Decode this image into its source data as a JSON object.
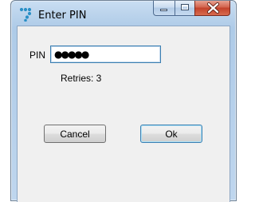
{
  "window": {
    "title": "Enter PIN",
    "icon": "app-dots-icon",
    "controls": {
      "minimize": "minimize-icon",
      "maximize": "maximize-icon",
      "close": "close-icon"
    }
  },
  "form": {
    "pin_label": "PIN",
    "pin_value": "●●●●●",
    "retries_text": "Retries: 3"
  },
  "buttons": {
    "cancel_label": "Cancel",
    "ok_label": "Ok"
  },
  "colors": {
    "title_bar": "#bcd4ec",
    "client_bg": "#f0f0f0",
    "close_button": "#c3412a",
    "input_border": "#3c7fb1"
  }
}
